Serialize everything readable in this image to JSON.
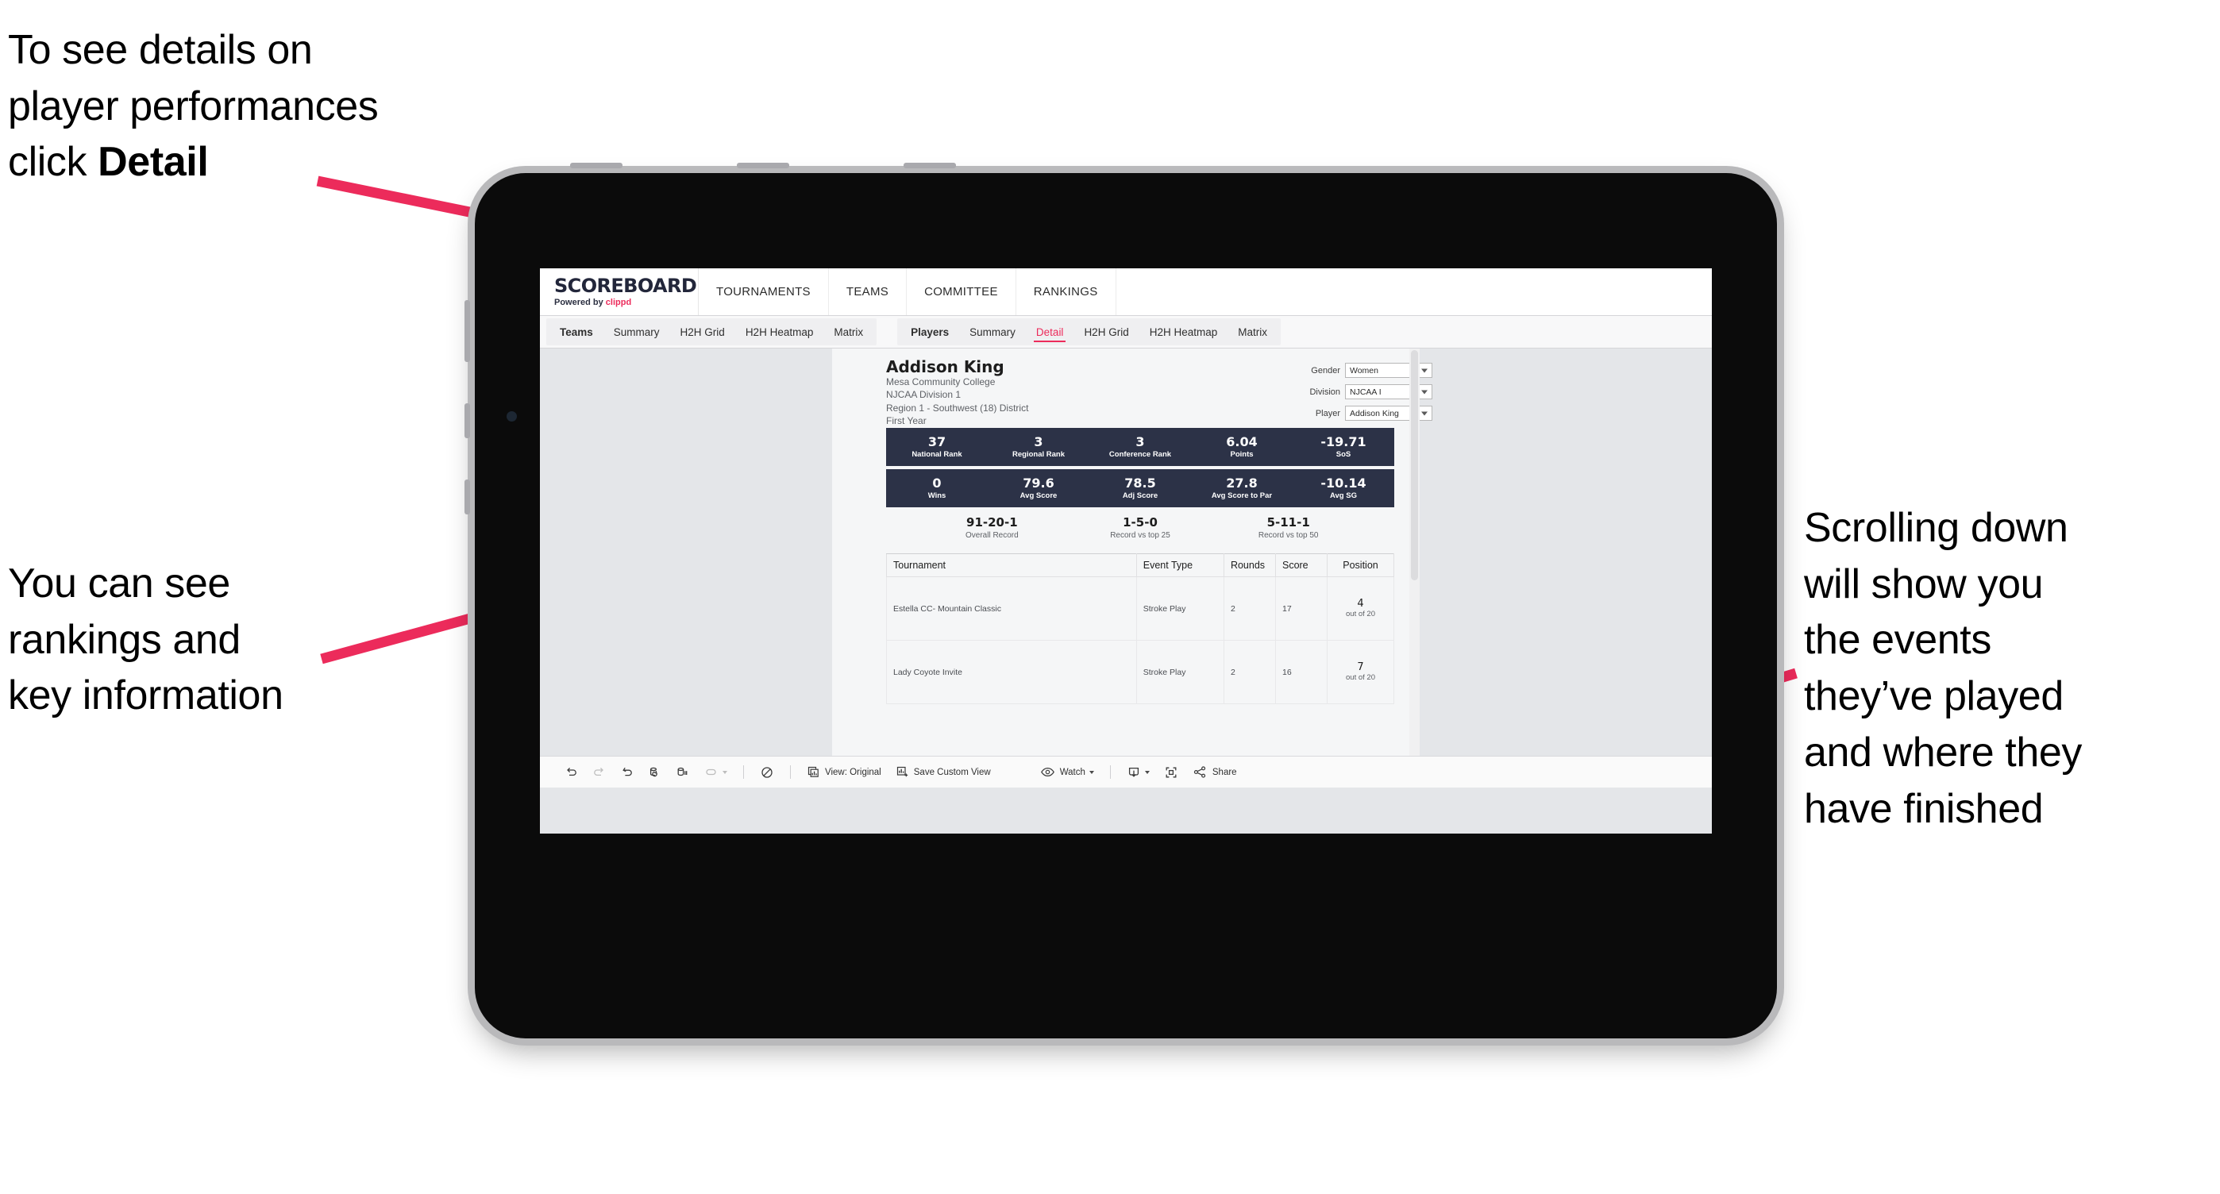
{
  "annotations": {
    "top_left": "To see details on\nplayer performances\nclick ",
    "top_left_bold": "Detail",
    "bottom_left": "You can see\nrankings and\nkey information",
    "right": "Scrolling down\nwill show you\nthe events\nthey’ve played\nand where they\nhave finished"
  },
  "colors": {
    "accent_pink": "#ec2b5b",
    "stat_navy": "#2c3247",
    "screen_bg": "#e4e6e9"
  },
  "brand": {
    "logo_main": "SCOREBOARD",
    "logo_sub_prefix": "Powered by ",
    "logo_sub_brand": "clippd"
  },
  "top_nav": [
    {
      "label": "TOURNAMENTS"
    },
    {
      "label": "TEAMS"
    },
    {
      "label": "COMMITTEE"
    },
    {
      "label": "RANKINGS"
    }
  ],
  "tab_groups": [
    {
      "lead": "Teams",
      "tabs": [
        {
          "label": "Summary",
          "active": false
        },
        {
          "label": "H2H Grid",
          "active": false
        },
        {
          "label": "H2H Heatmap",
          "active": false
        },
        {
          "label": "Matrix",
          "active": false
        }
      ]
    },
    {
      "lead": "Players",
      "tabs": [
        {
          "label": "Summary",
          "active": false
        },
        {
          "label": "Detail",
          "active": true
        },
        {
          "label": "H2H Grid",
          "active": false
        },
        {
          "label": "H2H Heatmap",
          "active": false
        },
        {
          "label": "Matrix",
          "active": false
        }
      ]
    }
  ],
  "player": {
    "name": "Addison King",
    "school": "Mesa Community College",
    "division": "NJCAA Division 1",
    "region": "Region 1 - Southwest (18) District",
    "year": "First Year"
  },
  "filters": [
    {
      "label": "Gender",
      "value": "Women"
    },
    {
      "label": "Division",
      "value": "NJCAA I"
    },
    {
      "label": "Player",
      "value": "Addison King"
    }
  ],
  "stats_row_1": [
    {
      "value": "37",
      "label": "National Rank"
    },
    {
      "value": "3",
      "label": "Regional Rank"
    },
    {
      "value": "3",
      "label": "Conference Rank"
    },
    {
      "value": "6.04",
      "label": "Points"
    },
    {
      "value": "-19.71",
      "label": "SoS"
    }
  ],
  "stats_row_2": [
    {
      "value": "0",
      "label": "Wins"
    },
    {
      "value": "79.6",
      "label": "Avg Score"
    },
    {
      "value": "78.5",
      "label": "Adj Score"
    },
    {
      "value": "27.8",
      "label": "Avg Score to Par"
    },
    {
      "value": "-10.14",
      "label": "Avg SG"
    }
  ],
  "records": [
    {
      "value": "91-20-1",
      "label": "Overall Record"
    },
    {
      "value": "1-5-0",
      "label": "Record vs top 25"
    },
    {
      "value": "5-11-1",
      "label": "Record vs top 50"
    }
  ],
  "tournament_table": {
    "headers": [
      "Tournament",
      "Event Type",
      "Rounds",
      "Score",
      "Position"
    ],
    "rows": [
      {
        "tournament": "Estella CC- Mountain Classic",
        "event_type": "Stroke Play",
        "rounds": "2",
        "score": "17",
        "position_num": "4",
        "position_of": "out of 20"
      },
      {
        "tournament": "Lady Coyote Invite",
        "event_type": "Stroke Play",
        "rounds": "2",
        "score": "16",
        "position_num": "7",
        "position_of": "out of 20"
      }
    ]
  },
  "toolbar": {
    "view_label": "View: Original",
    "save_label": "Save Custom View",
    "watch_label": "Watch",
    "share_label": "Share"
  }
}
